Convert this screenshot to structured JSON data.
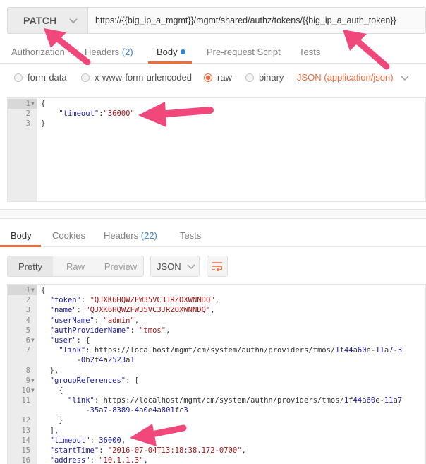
{
  "request": {
    "method": "PATCH",
    "url": "https://{{big_ip_a_mgmt}}/mgmt/shared/authz/tokens/{{big_ip_a_auth_token}}"
  },
  "request_tabs": [
    {
      "label": "Authorization",
      "count": ""
    },
    {
      "label": "Headers",
      "count": "(2)"
    },
    {
      "label": "Body",
      "count": ""
    },
    {
      "label": "Pre-request Script",
      "count": ""
    },
    {
      "label": "Tests",
      "count": ""
    }
  ],
  "body_types": [
    "form-data",
    "x-www-form-urlencoded",
    "raw",
    "binary"
  ],
  "body_type_selected": "raw",
  "content_type": "JSON (application/json)",
  "request_body": {
    "line_numbers": [
      "1",
      "2",
      "3"
    ],
    "lines": [
      "{",
      "    \"timeout\":\"36000\"",
      "}"
    ]
  },
  "response_tabs": [
    {
      "label": "Body",
      "count": ""
    },
    {
      "label": "Cookies",
      "count": ""
    },
    {
      "label": "Headers",
      "count": "(22)"
    },
    {
      "label": "Tests",
      "count": ""
    }
  ],
  "view_modes": [
    "Pretty",
    "Raw",
    "Preview"
  ],
  "view_mode_selected": "Pretty",
  "format": "JSON",
  "response_body": {
    "line_numbers": [
      "1",
      "2",
      "3",
      "4",
      "5",
      "6",
      "7",
      "",
      "8",
      "9",
      "10",
      "11",
      "",
      "12",
      "13",
      "14",
      "15",
      "16"
    ],
    "lines": [
      "{",
      "  \"token\": \"QJXK6HQWZFW35VC3JRZOXWNNDQ\",",
      "  \"name\": \"QJXK6HQWZFW35VC3JRZOXWNNDQ\",",
      "  \"userName\": \"admin\",",
      "  \"authProviderName\": \"tmos\",",
      "  \"user\": {",
      "    \"link\": \"https://localhost/mgmt/cm/system/authn/providers/tmos/1f44a60e-11a7-3",
      "        -0b2f4a2523a1\"",
      "  },",
      "  \"groupReferences\": [",
      "    {",
      "      \"link\": \"https://localhost/mgmt/cm/system/authn/providers/tmos/1f44a60e-11a7",
      "          -35a7-8389-4a0e4a801fc3\"",
      "    }",
      "  ],",
      "  \"timeout\": 36000,",
      "  \"startTime\": \"2016-07-04T13:18:38.172-0700\",",
      "  \"address\": \"10.1.1.3\","
    ]
  },
  "colors": {
    "accent": "#f26b3a",
    "annotation_arrow": "#f0487a",
    "json_key": "#1a1aa6",
    "json_string": "#a31515"
  }
}
